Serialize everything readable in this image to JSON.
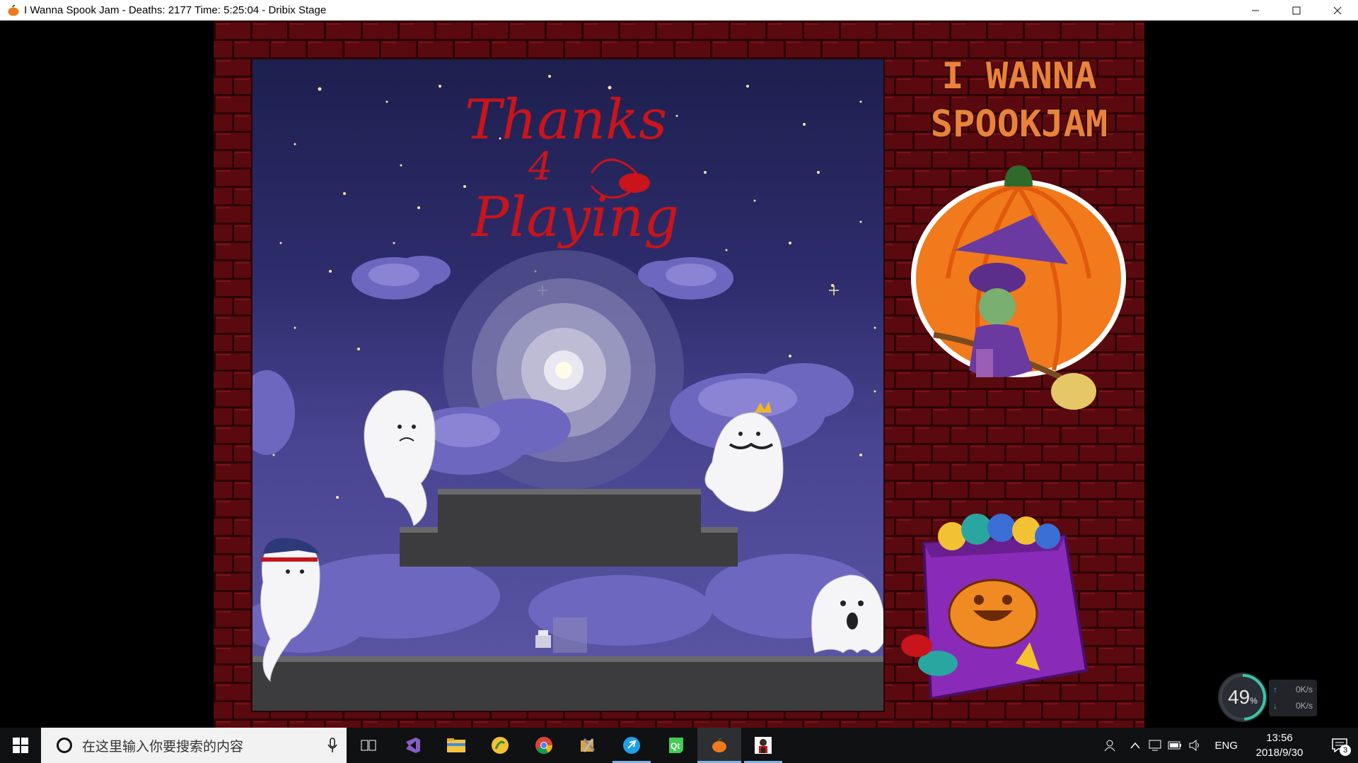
{
  "window": {
    "title": "I Wanna Spook Jam - Deaths: 2177 Time: 5:25:04 - Dribix Stage",
    "controls": {
      "minimize": "—",
      "maximize": "☐",
      "close": "✕"
    }
  },
  "game": {
    "logo_line1": "I WANNA",
    "logo_line2": "SPOOKJAM",
    "end_message_line1": "Thanks",
    "end_message_line2": "4",
    "end_message_line3": "Playing"
  },
  "net_monitor": {
    "percent": "49",
    "percent_unit": "%",
    "upload": "0",
    "upload_unit": "K/s",
    "download": "0",
    "download_unit": "K/s"
  },
  "taskbar": {
    "search_placeholder": "在这里输入你要搜索的内容",
    "apps": [
      {
        "name": "task-view",
        "running": false
      },
      {
        "name": "visual-studio",
        "running": false
      },
      {
        "name": "file-explorer",
        "running": false
      },
      {
        "name": "yellow-app",
        "running": false
      },
      {
        "name": "chrome",
        "running": false
      },
      {
        "name": "tool-app",
        "running": false
      },
      {
        "name": "blue-app",
        "running": true
      },
      {
        "name": "green-qt-app",
        "running": false
      },
      {
        "name": "spookjam-game",
        "running": true,
        "active": true
      },
      {
        "name": "character-app",
        "running": true
      }
    ],
    "tray": {
      "language": "ENG",
      "time": "13:56",
      "date": "2018/9/30",
      "notification_count": "3"
    }
  },
  "colors": {
    "brick": "#5a0a0e",
    "brick_mortar": "#2c0306",
    "sky_top": "#1d1f4e",
    "sky_bottom": "#5d58a6",
    "logo_orange": "#e9823a",
    "message_red": "#c8141a"
  }
}
